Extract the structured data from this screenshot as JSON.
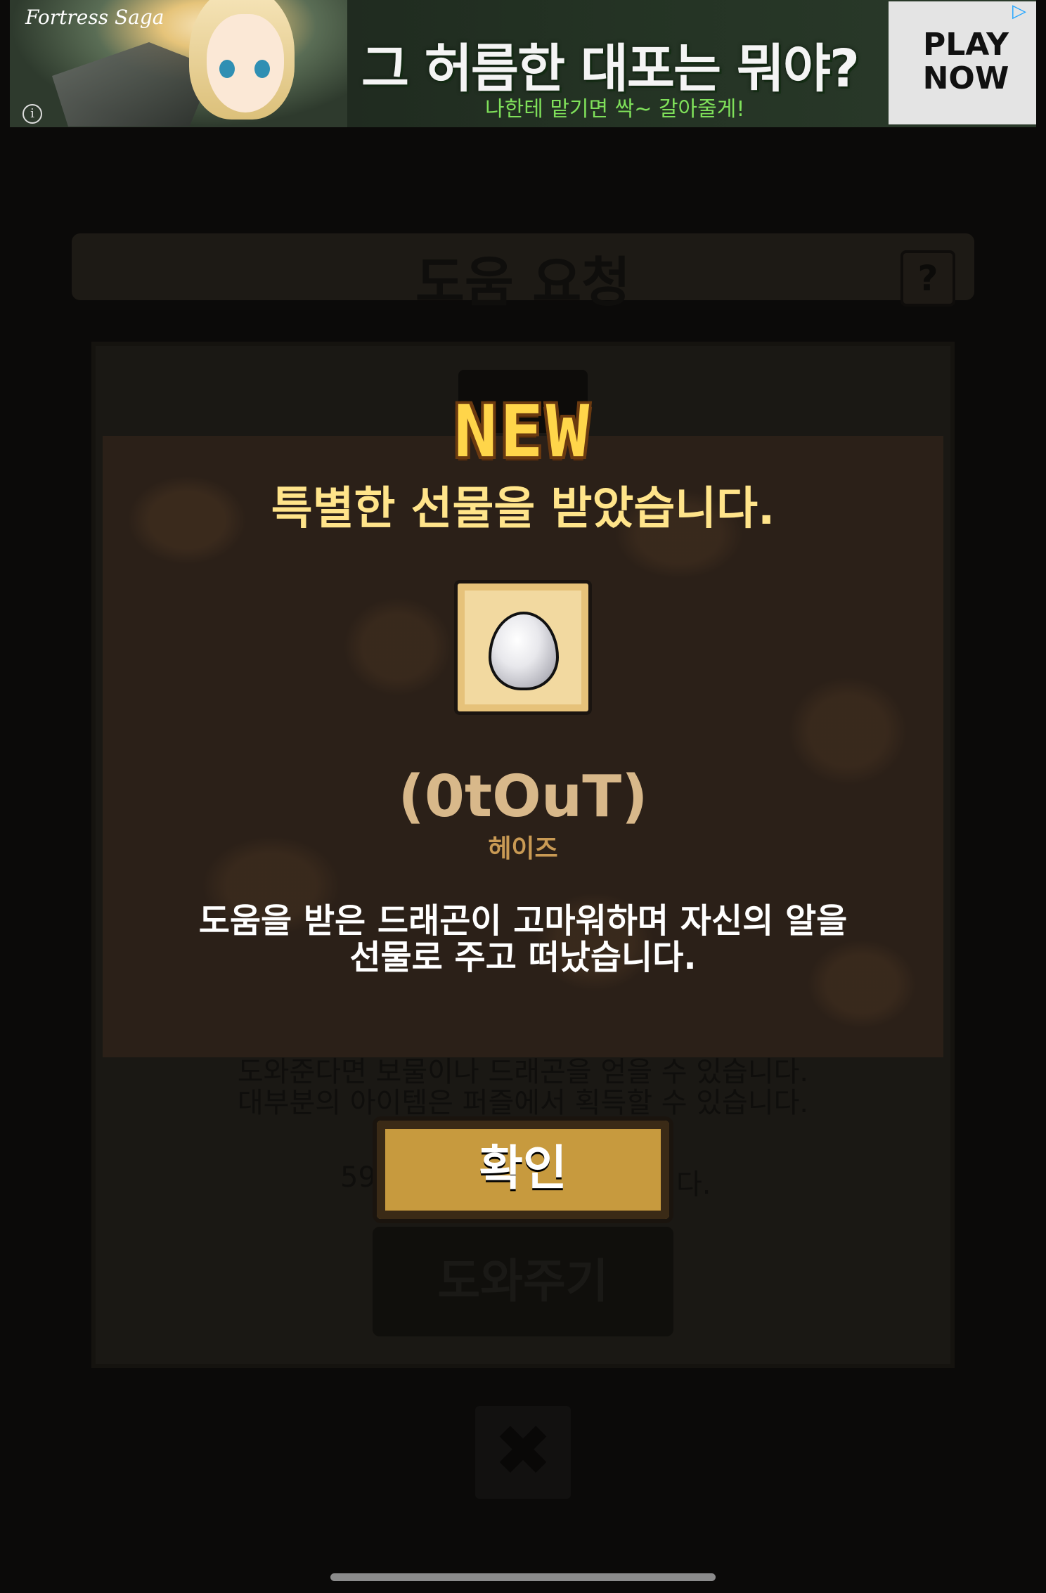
{
  "ad": {
    "logo": "Fortress Saga",
    "headline": "그 허름한 대포는 뭐야?",
    "subline": "나한테 맡기면 싹~ 갈아줄게!",
    "cta": "PLAY NOW",
    "info_icon": "info-icon",
    "adchoices_icon": "adchoices-icon"
  },
  "background_screen": {
    "title": "도움 요청",
    "help_icon_label": "?",
    "hint_line_1": "도와준다면 보물이나 드래곤을 얻을 수 있습니다.",
    "hint_line_2": "대부분의 아이템은 퍼즐에서 획득할 수 있습니다.",
    "counter_left": "59",
    "counter_right": "다.",
    "help_button": "도와주기",
    "close_icon": "close-icon"
  },
  "reward_popup": {
    "badge": "NEW",
    "title": "특별한 선물을 받았습니다.",
    "item_icon": "dragon-egg-icon",
    "item_name": "(0tOuT)",
    "item_type": "헤이즈",
    "description_line_1": "도움을 받은 드래곤이 고마워하며 자신의 알을",
    "description_line_2": "선물로 주고 떠났습니다.",
    "confirm_button": "확인"
  },
  "colors": {
    "accent_gold": "#ffd54a",
    "title_yellow": "#ffe48a",
    "item_name": "#d8b88a",
    "popup_bg": "#2b2018",
    "button_gold": "#c79a3e"
  }
}
